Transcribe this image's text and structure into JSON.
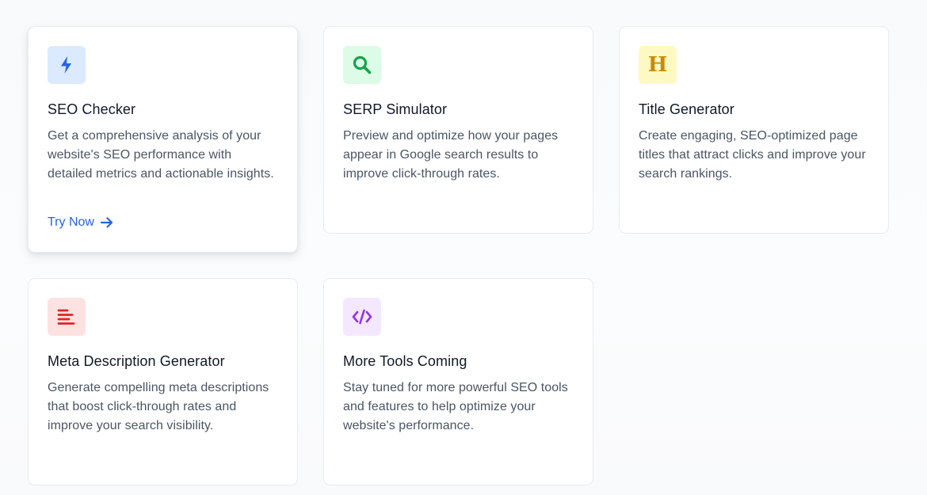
{
  "cards": [
    {
      "title": "SEO Checker",
      "description": "Get a comprehensive analysis of your website's SEO performance with detailed metrics and actionable insights.",
      "icon": "lightning-icon",
      "icon_bg": "#dbeafe",
      "icon_color": "#2563eb",
      "link_label": "Try Now"
    },
    {
      "title": "SERP Simulator",
      "description": "Preview and optimize how your pages appear in Google search results to improve click-through rates.",
      "icon": "search-icon",
      "icon_bg": "#dcfce7",
      "icon_color": "#16a34a"
    },
    {
      "title": "Title Generator",
      "description": "Create engaging, SEO-optimized page titles that attract clicks and improve your search rankings.",
      "icon": "heading-icon",
      "icon_bg": "#fef9c3",
      "icon_color": "#ca8a04",
      "icon_glyph": "H"
    },
    {
      "title": "Meta Description Generator",
      "description": "Generate compelling meta descriptions that boost click-through rates and improve your search visibility.",
      "icon": "align-left-icon",
      "icon_bg": "#fee2e2",
      "icon_color": "#dc2626"
    },
    {
      "title": "More Tools Coming",
      "description": "Stay tuned for more powerful SEO tools and features to help optimize your website's performance.",
      "icon": "code-icon",
      "icon_bg": "#f3e8ff",
      "icon_color": "#9333ea"
    }
  ]
}
